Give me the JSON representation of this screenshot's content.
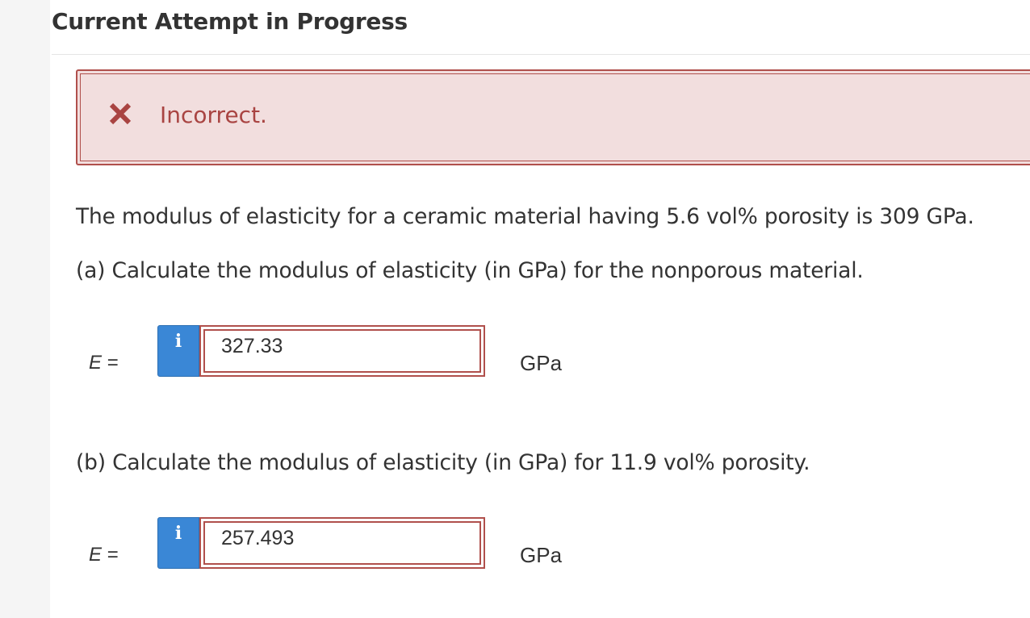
{
  "header": {
    "title": "Current Attempt in Progress"
  },
  "feedback": {
    "icon": "close-icon",
    "text": "Incorrect.",
    "color": "#a94442",
    "background": "#f2dede"
  },
  "question": {
    "intro": "The modulus of elasticity for a ceramic material having 5.6 vol% porosity is 309 GPa.",
    "parts": [
      {
        "prompt": "(a) Calculate the modulus of elasticity (in GPa) for the nonporous material.",
        "variable": "E",
        "equals": "=",
        "info_icon": "info-icon",
        "info_label": "i",
        "answer": "327.33",
        "unit": "GPa"
      },
      {
        "prompt": "(b) Calculate the modulus of elasticity (in GPa) for 11.9 vol% porosity.",
        "variable": "E",
        "equals": "=",
        "info_icon": "info-icon",
        "info_label": "i",
        "answer": "257.493",
        "unit": "GPa"
      }
    ]
  },
  "colors": {
    "accent": "#3a87d6",
    "error_border": "#b0504c"
  }
}
